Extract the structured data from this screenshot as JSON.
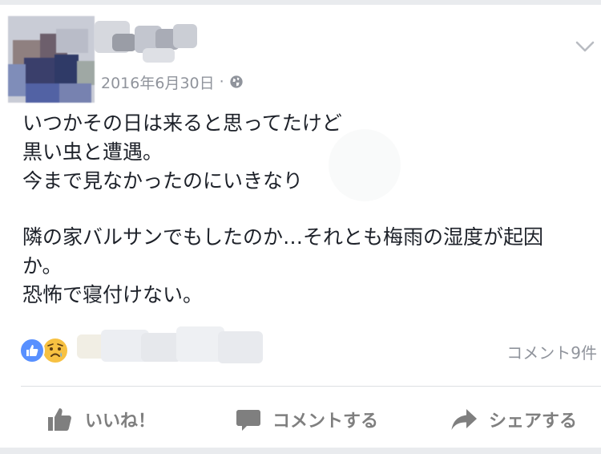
{
  "post": {
    "timestamp": "2016年6月30日",
    "separator": "·",
    "body_lines": [
      "いつかその日は来ると思ってたけど",
      "黒い虫と遭遇。",
      "今まで見なかったのにいきなり",
      "",
      "隣の家バルサンでもしたのか…それとも梅雨の湿度が起因",
      "か。",
      "恐怖で寝付けない。"
    ]
  },
  "reactions": {
    "comment_count": "コメント9件"
  },
  "actions": {
    "like_label": "いいね！",
    "comment_label": "コメントする",
    "share_label": "シェアする"
  },
  "colors": {
    "like_blue": "#5890ff",
    "action_gray": "#7f7f7f",
    "meta_gray": "#90949c",
    "text": "#1d2129"
  }
}
